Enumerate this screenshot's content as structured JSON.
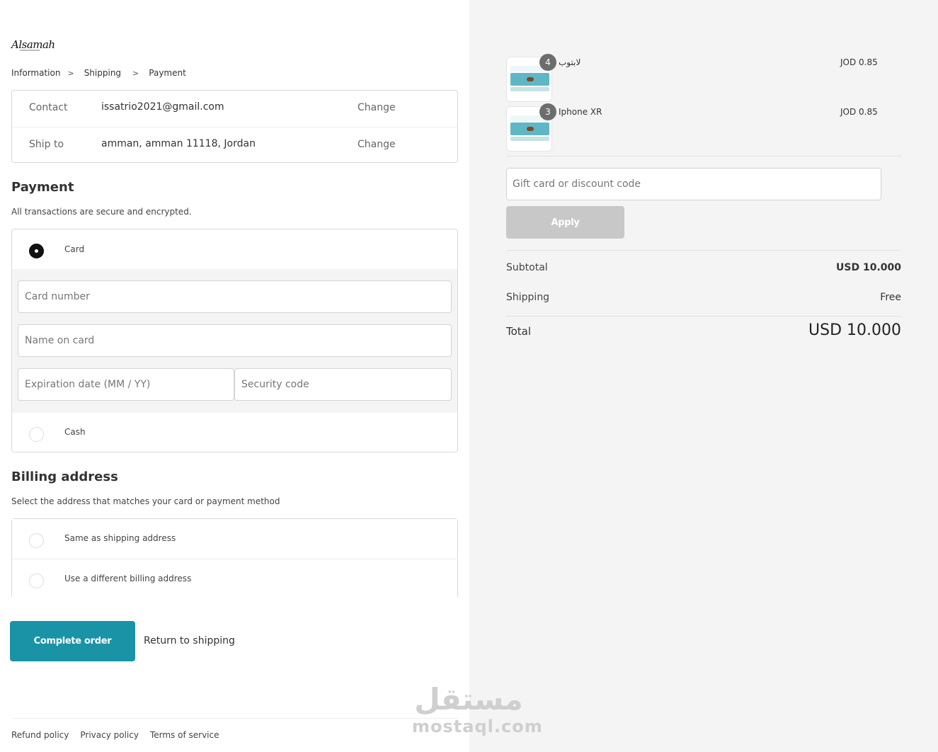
{
  "brand": {
    "logo_text": "Alsamah"
  },
  "breadcrumb": {
    "items": [
      "Information",
      "Shipping",
      "Payment"
    ],
    "separator": ">"
  },
  "review": {
    "contact_label": "Contact",
    "contact_value": "issatrio2021@gmail.com",
    "ship_label": "Ship to",
    "ship_value": "amman, amman 11118, Jordan",
    "change_label": "Change"
  },
  "payment": {
    "title": "Payment",
    "subtitle": "All transactions are secure and encrypted.",
    "options": [
      {
        "label": "Card",
        "selected": true
      },
      {
        "label": "Cash",
        "selected": false
      }
    ],
    "fields": {
      "card_number_placeholder": "Card number",
      "name_placeholder": "Name on card",
      "expiry_placeholder": "Expiration date (MM / YY)",
      "security_placeholder": "Security code"
    }
  },
  "billing": {
    "title": "Billing address",
    "subtitle": "Select the address that matches your card or payment method",
    "options": [
      {
        "label": "Same as shipping address"
      },
      {
        "label": "Use a different billing address"
      }
    ]
  },
  "actions": {
    "complete_label": "Complete order",
    "return_label": "Return to shipping"
  },
  "footer": {
    "links": [
      "Refund policy",
      "Privacy policy",
      "Terms of service"
    ]
  },
  "cart": {
    "items": [
      {
        "quantity": "4",
        "name": "لابتوب",
        "price": "JOD 0.85"
      },
      {
        "quantity": "3",
        "name": "Iphone XR",
        "price": "JOD 0.85"
      }
    ],
    "discount_placeholder": "Gift card or discount code",
    "apply_label": "Apply",
    "subtotal_label": "Subtotal",
    "subtotal_value": "USD 10.000",
    "shipping_label": "Shipping",
    "shipping_value": "Free",
    "total_label": "Total",
    "total_value": "USD 10.000"
  },
  "watermark": {
    "arabic": "مستقل",
    "latin": "mostaql.com"
  },
  "colors": {
    "accent": "#1a93a6",
    "sidebar_bg": "#f4f4f4",
    "apply_disabled": "#c8c8c8"
  }
}
